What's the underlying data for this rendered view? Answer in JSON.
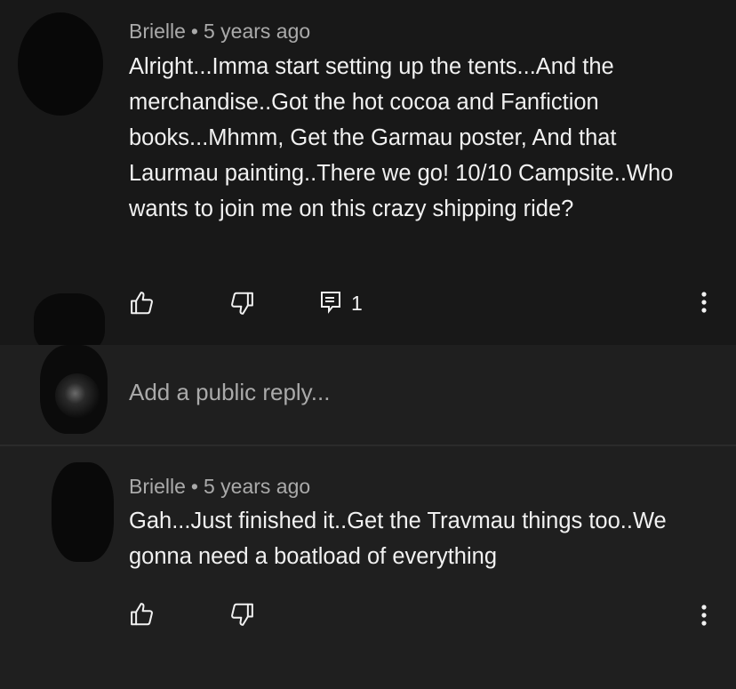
{
  "comments": [
    {
      "author": "Brielle",
      "separator": "•",
      "timestamp": "5 years ago",
      "text": "Alright...Imma start setting up the tents...And the merchandise..Got the hot cocoa and Fanfiction books...Mhmm, Get the Garmau poster, And that Laurmau painting..There we go! 10/10 Campsite..Who wants to join me on this crazy shipping ride?",
      "reply_count": "1",
      "icons": [
        "thumbs-up-icon",
        "thumbs-down-icon",
        "reply-icon",
        "more-vertical-icon"
      ]
    },
    {
      "author": "Brielle",
      "separator": "•",
      "timestamp": "5 years ago",
      "text": "Gah...Just finished it..Get the Travmau things too..We gonna need a boatload of everything",
      "icons": [
        "thumbs-up-icon",
        "thumbs-down-icon",
        "more-vertical-icon"
      ]
    }
  ],
  "reply_box": {
    "placeholder": "Add a public reply..."
  },
  "colors": {
    "background": "#181818",
    "reply_background": "#1f1f1f",
    "text_primary": "#f1f1f1",
    "text_secondary": "#aaaaaa"
  }
}
